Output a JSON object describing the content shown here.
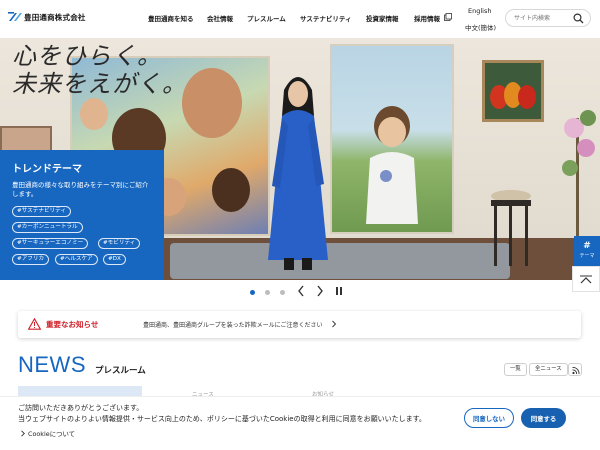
{
  "header": {
    "logo_text": "豊田通商株式会社",
    "nav": [
      {
        "label": "豊田通商を知る"
      },
      {
        "label": "会社情報"
      },
      {
        "label": "プレスルーム"
      },
      {
        "label": "サステナビリティ"
      },
      {
        "label": "投資家情報"
      },
      {
        "label": "採用情報"
      }
    ],
    "lang_en": "English",
    "lang_zh": "中文(簡体)",
    "search_placeholder": "サイト内検索"
  },
  "hero": {
    "tagline_line1": "心をひらく。",
    "tagline_line2": "未来をえがく。"
  },
  "trend": {
    "title": "トレンドテーマ",
    "description": "豊田通商の様々な取り組みをテーマ別にご紹介します。",
    "tags": [
      "#サステナビリティ",
      "#カーボンニュートラル",
      "#サーキュラーエコノミー",
      "#モビリティ",
      "#アフリカ",
      "#ヘルスケア",
      "#DX"
    ]
  },
  "side": {
    "theme_hash": "#",
    "theme_label": "テーマ"
  },
  "slider": {
    "slide_count": 3,
    "active_slide": 1
  },
  "alert": {
    "title": "重要なお知らせ",
    "message": "豊田通商、豊田通商グループを装った詐欺メールにご注意ください"
  },
  "news": {
    "title_en": "NEWS",
    "title_ja": "プレスルーム",
    "btn_list": "一覧",
    "btn_all": "全ニュース",
    "tab_labels": [
      "ニュース",
      "お知らせ"
    ]
  },
  "cookie": {
    "line1": "ご訪問いただきありがとうございます。",
    "line2": "当ウェブサイトのよりよい情報提供・サービス向上のため、ポリシーに基づいたCookieの取得と利用に同意をお願いいたします。",
    "link": "Cookieについて",
    "decline": "同意しない",
    "accept": "同意する"
  },
  "colors": {
    "brand_blue": "#1767c1",
    "alert_red": "#d0202a"
  }
}
